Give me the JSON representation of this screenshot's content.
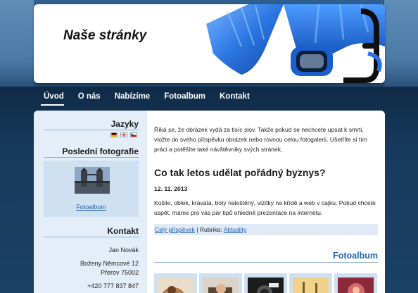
{
  "site": {
    "title": "Naše stránky"
  },
  "nav": {
    "items": [
      {
        "label": "Úvod",
        "active": true
      },
      {
        "label": "O nás"
      },
      {
        "label": "Nabízíme"
      },
      {
        "label": "Fotoalbum"
      },
      {
        "label": "Kontakt"
      }
    ]
  },
  "sidebar": {
    "languages": {
      "heading": "Jazyky",
      "flags": [
        "flag-de-icon",
        "flag-en-icon",
        "flag-cz-icon"
      ]
    },
    "latest_photo": {
      "heading": "Poslední fotografie",
      "link": "Fotoalbum"
    },
    "contact": {
      "heading": "Kontakt",
      "name": "Jan Novák",
      "street": "Boženy Němcové 12",
      "city": "Přerov 75002",
      "phone": "+420 777 837 847"
    }
  },
  "main": {
    "intro_lines": [
      "Říká se, že obrázek vydá za tisíc slov. Takže pokud se nechcete upsat k smrti,",
      "vložte do svého příspěvku obrázek nebo rovnou celou fotogalerii. Ušetříte si tím",
      "práci a potěšíte také návštěvníky svých stránek."
    ],
    "article": {
      "title": "Co tak letos udělat pořádný byznys?",
      "date": "12. 11. 2013",
      "text_lines": [
        "Košile, oblek, kravata, boty naleštěný, vizitky na křídě a web v cajku. Pokud chcete",
        "uspět, máme pro vás pár tipů ohledně prezentace na internetu."
      ],
      "read_more": "Celý příspěvek",
      "category_sep": " | Rubrika: ",
      "category": "Aktuality"
    },
    "gallery": {
      "heading": "Fotoalbum"
    }
  },
  "colors": {
    "accent": "#2369b2",
    "link": "#1f5fa8",
    "sidebar_bg": "#e4eef8",
    "page_bg": "#173350"
  }
}
